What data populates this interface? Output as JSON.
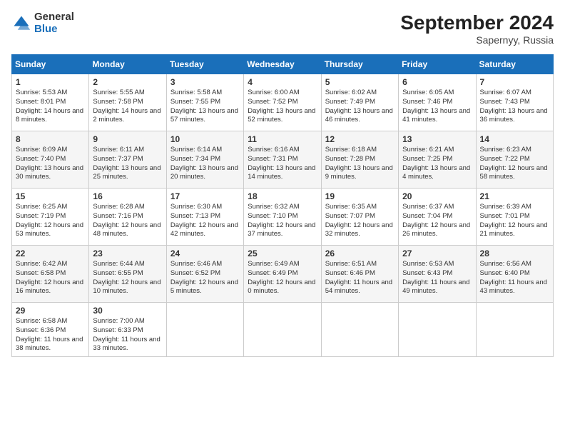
{
  "header": {
    "logo": {
      "general": "General",
      "blue": "Blue"
    },
    "month": "September 2024",
    "location": "Sapernyy, Russia"
  },
  "weekdays": [
    "Sunday",
    "Monday",
    "Tuesday",
    "Wednesday",
    "Thursday",
    "Friday",
    "Saturday"
  ],
  "weeks": [
    [
      {
        "day": "1",
        "sunrise": "5:53 AM",
        "sunset": "8:01 PM",
        "daylight": "14 hours and 8 minutes."
      },
      {
        "day": "2",
        "sunrise": "5:55 AM",
        "sunset": "7:58 PM",
        "daylight": "14 hours and 2 minutes."
      },
      {
        "day": "3",
        "sunrise": "5:58 AM",
        "sunset": "7:55 PM",
        "daylight": "13 hours and 57 minutes."
      },
      {
        "day": "4",
        "sunrise": "6:00 AM",
        "sunset": "7:52 PM",
        "daylight": "13 hours and 52 minutes."
      },
      {
        "day": "5",
        "sunrise": "6:02 AM",
        "sunset": "7:49 PM",
        "daylight": "13 hours and 46 minutes."
      },
      {
        "day": "6",
        "sunrise": "6:05 AM",
        "sunset": "7:46 PM",
        "daylight": "13 hours and 41 minutes."
      },
      {
        "day": "7",
        "sunrise": "6:07 AM",
        "sunset": "7:43 PM",
        "daylight": "13 hours and 36 minutes."
      }
    ],
    [
      {
        "day": "8",
        "sunrise": "6:09 AM",
        "sunset": "7:40 PM",
        "daylight": "13 hours and 30 minutes."
      },
      {
        "day": "9",
        "sunrise": "6:11 AM",
        "sunset": "7:37 PM",
        "daylight": "13 hours and 25 minutes."
      },
      {
        "day": "10",
        "sunrise": "6:14 AM",
        "sunset": "7:34 PM",
        "daylight": "13 hours and 20 minutes."
      },
      {
        "day": "11",
        "sunrise": "6:16 AM",
        "sunset": "7:31 PM",
        "daylight": "13 hours and 14 minutes."
      },
      {
        "day": "12",
        "sunrise": "6:18 AM",
        "sunset": "7:28 PM",
        "daylight": "13 hours and 9 minutes."
      },
      {
        "day": "13",
        "sunrise": "6:21 AM",
        "sunset": "7:25 PM",
        "daylight": "13 hours and 4 minutes."
      },
      {
        "day": "14",
        "sunrise": "6:23 AM",
        "sunset": "7:22 PM",
        "daylight": "12 hours and 58 minutes."
      }
    ],
    [
      {
        "day": "15",
        "sunrise": "6:25 AM",
        "sunset": "7:19 PM",
        "daylight": "12 hours and 53 minutes."
      },
      {
        "day": "16",
        "sunrise": "6:28 AM",
        "sunset": "7:16 PM",
        "daylight": "12 hours and 48 minutes."
      },
      {
        "day": "17",
        "sunrise": "6:30 AM",
        "sunset": "7:13 PM",
        "daylight": "12 hours and 42 minutes."
      },
      {
        "day": "18",
        "sunrise": "6:32 AM",
        "sunset": "7:10 PM",
        "daylight": "12 hours and 37 minutes."
      },
      {
        "day": "19",
        "sunrise": "6:35 AM",
        "sunset": "7:07 PM",
        "daylight": "12 hours and 32 minutes."
      },
      {
        "day": "20",
        "sunrise": "6:37 AM",
        "sunset": "7:04 PM",
        "daylight": "12 hours and 26 minutes."
      },
      {
        "day": "21",
        "sunrise": "6:39 AM",
        "sunset": "7:01 PM",
        "daylight": "12 hours and 21 minutes."
      }
    ],
    [
      {
        "day": "22",
        "sunrise": "6:42 AM",
        "sunset": "6:58 PM",
        "daylight": "12 hours and 16 minutes."
      },
      {
        "day": "23",
        "sunrise": "6:44 AM",
        "sunset": "6:55 PM",
        "daylight": "12 hours and 10 minutes."
      },
      {
        "day": "24",
        "sunrise": "6:46 AM",
        "sunset": "6:52 PM",
        "daylight": "12 hours and 5 minutes."
      },
      {
        "day": "25",
        "sunrise": "6:49 AM",
        "sunset": "6:49 PM",
        "daylight": "12 hours and 0 minutes."
      },
      {
        "day": "26",
        "sunrise": "6:51 AM",
        "sunset": "6:46 PM",
        "daylight": "11 hours and 54 minutes."
      },
      {
        "day": "27",
        "sunrise": "6:53 AM",
        "sunset": "6:43 PM",
        "daylight": "11 hours and 49 minutes."
      },
      {
        "day": "28",
        "sunrise": "6:56 AM",
        "sunset": "6:40 PM",
        "daylight": "11 hours and 43 minutes."
      }
    ],
    [
      {
        "day": "29",
        "sunrise": "6:58 AM",
        "sunset": "6:36 PM",
        "daylight": "11 hours and 38 minutes."
      },
      {
        "day": "30",
        "sunrise": "7:00 AM",
        "sunset": "6:33 PM",
        "daylight": "11 hours and 33 minutes."
      },
      null,
      null,
      null,
      null,
      null
    ]
  ]
}
